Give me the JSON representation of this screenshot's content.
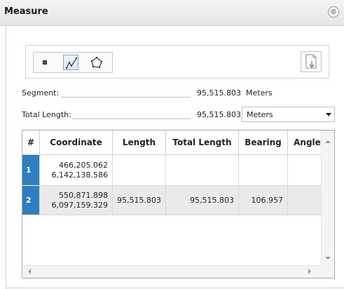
{
  "window": {
    "title": "Measure",
    "close_symbol": "⊗"
  },
  "toolbar": {
    "tools": [
      {
        "icon": "point-tool-icon",
        "active": false
      },
      {
        "icon": "line-tool-icon",
        "active": true
      },
      {
        "icon": "polygon-tool-icon",
        "active": false
      }
    ],
    "export_icon": "export-icon"
  },
  "segment": {
    "label": "Segment:",
    "value": "95,515.803",
    "unit": "Meters"
  },
  "total_length": {
    "label": "Total Length:",
    "value": "95,515.803",
    "unit_selected": "Meters"
  },
  "table": {
    "columns": [
      "#",
      "Coordinate",
      "Length",
      "Total Length",
      "Bearing",
      "Angle"
    ],
    "rows": [
      {
        "num": "1",
        "coord_x": "466,205.062",
        "coord_y": "6,142,138.586",
        "length": "",
        "total_length": "",
        "bearing": "",
        "angle": ""
      },
      {
        "num": "2",
        "coord_x": "550,871.898",
        "coord_y": "6,097,159.329",
        "length": "95,515.803",
        "total_length": "95,515.803",
        "bearing": "106.957",
        "angle": ""
      }
    ]
  },
  "colors": {
    "accent": "#2d7fbf",
    "selected_row": "#eaeaea"
  }
}
